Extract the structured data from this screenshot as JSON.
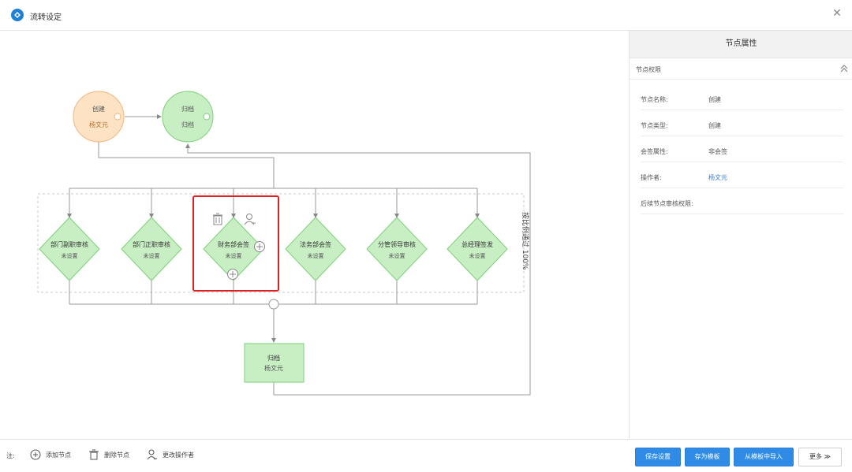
{
  "dialog": {
    "title": "流转设定"
  },
  "flow": {
    "top_nodes": [
      {
        "title": "创建",
        "subtitle": "杨文元"
      },
      {
        "title": "归档",
        "subtitle": "归档"
      }
    ],
    "parallel_nodes": [
      {
        "title": "部门副职审核",
        "subtitle": "未设置"
      },
      {
        "title": "部门正职审核",
        "subtitle": "未设置"
      },
      {
        "title": "财务部会签",
        "subtitle": "未设置"
      },
      {
        "title": "法务部会签",
        "subtitle": "未设置"
      },
      {
        "title": "分管领导审核",
        "subtitle": "未设置"
      },
      {
        "title": "总经理签发",
        "subtitle": "未设置"
      }
    ],
    "group_label": "按比例通过 100%",
    "bottom_node": {
      "title": "归档",
      "subtitle": "杨文元"
    }
  },
  "panel": {
    "header": "节点属性",
    "section_title": "节点权限",
    "rows": [
      {
        "label": "节点名称:",
        "value": "创建"
      },
      {
        "label": "节点类型:",
        "value": "创建"
      },
      {
        "label": "会签属性:",
        "value": "非会签"
      },
      {
        "label": "操作者:",
        "value": "杨文元"
      },
      {
        "label": "后续节点审核权限:",
        "value": ""
      }
    ]
  },
  "footer": {
    "note": "注:",
    "legend": [
      {
        "icon": "add-circle-icon",
        "label": "添加节点"
      },
      {
        "icon": "trash-icon",
        "label": "删除节点"
      },
      {
        "icon": "user-edit-icon",
        "label": "更改操作者"
      }
    ],
    "buttons": {
      "save": "保存设置",
      "save_template": "存为模板",
      "import_template": "从模板中导入",
      "more": "更多 ≫"
    }
  },
  "colors": {
    "accent": "#2f8be6",
    "create_node_fill": "#fde3c4",
    "create_node_stroke": "#f1b67c",
    "node_fill": "#c8efc4",
    "node_stroke": "#7ccf78",
    "selection": "#e02020"
  }
}
